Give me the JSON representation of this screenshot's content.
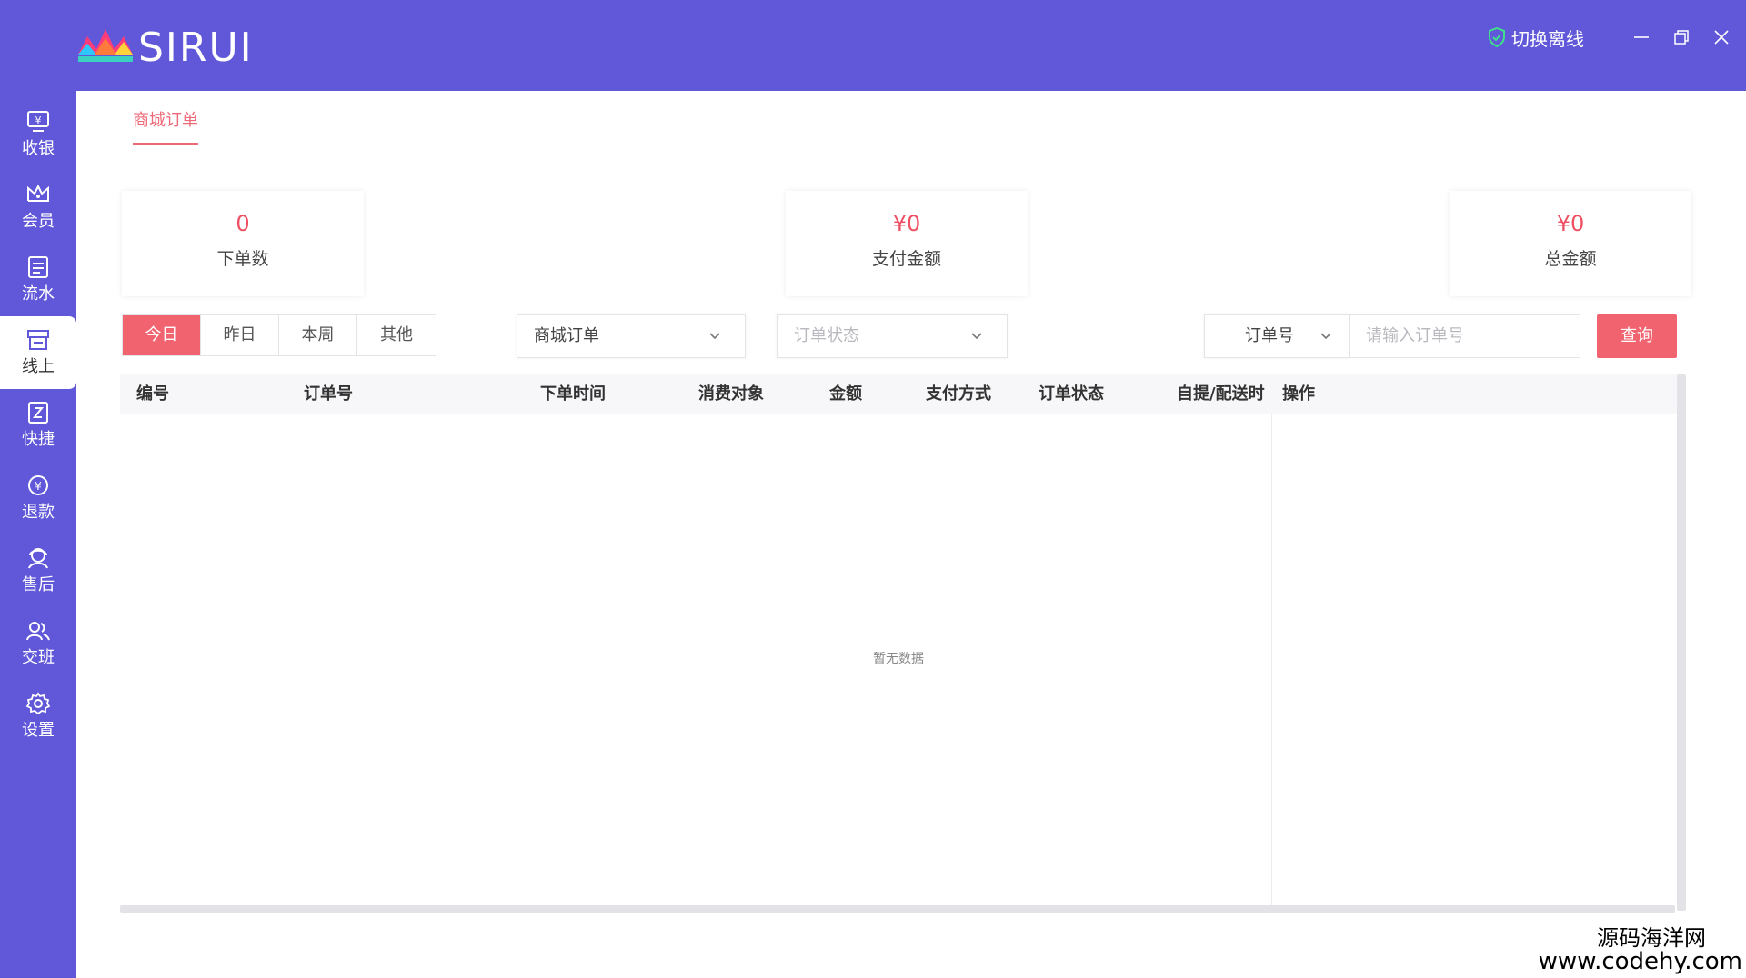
{
  "app": {
    "logo_text": "SIRUI",
    "offline_label": "切换离线"
  },
  "sidebar": {
    "items": [
      {
        "label": "收银",
        "icon": "cashier-icon"
      },
      {
        "label": "会员",
        "icon": "crown-icon"
      },
      {
        "label": "流水",
        "icon": "ledger-icon"
      },
      {
        "label": "线上",
        "icon": "store-icon",
        "active": true
      },
      {
        "label": "快捷",
        "icon": "quick-icon"
      },
      {
        "label": "退款",
        "icon": "refund-icon"
      },
      {
        "label": "售后",
        "icon": "support-icon"
      },
      {
        "label": "交班",
        "icon": "handover-icon"
      },
      {
        "label": "设置",
        "icon": "gear-icon"
      }
    ]
  },
  "tabs": {
    "active_label": "商城订单"
  },
  "stats": [
    {
      "value": "0",
      "label": "下单数"
    },
    {
      "value": "¥0",
      "label": "支付金额"
    },
    {
      "value": "¥0",
      "label": "总金额"
    }
  ],
  "period": {
    "options": [
      "今日",
      "昨日",
      "本周",
      "其他"
    ],
    "selected": "今日"
  },
  "filters": {
    "order_type": "商城订单",
    "order_status_placeholder": "订单状态",
    "search_field": "订单号",
    "search_placeholder": "请输入订单号",
    "query_label": "查询"
  },
  "table": {
    "columns": [
      "编号",
      "订单号",
      "下单时间",
      "消费对象",
      "金额",
      "支付方式",
      "订单状态",
      "自提/配送时",
      "操作"
    ],
    "rows": [],
    "empty_text": "暂无数据"
  },
  "watermark": {
    "line1": "源码海洋网",
    "line2": "www.codehy.com"
  },
  "colors": {
    "brand": "#6058d8",
    "accent": "#f0636f",
    "accent_text": "#ef4f62"
  }
}
